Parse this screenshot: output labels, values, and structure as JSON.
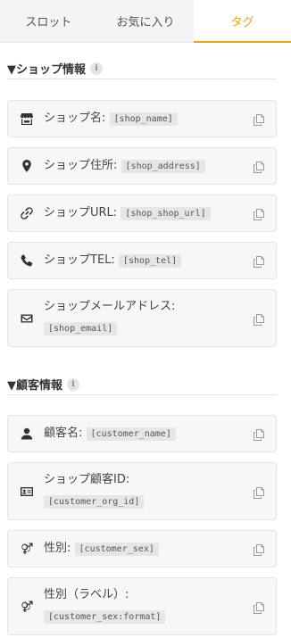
{
  "tabs": [
    {
      "label": "スロット",
      "active": false
    },
    {
      "label": "お気に入り",
      "active": false
    },
    {
      "label": "タグ",
      "active": true
    }
  ],
  "sections": [
    {
      "title": "▼ショップ情報",
      "info": "i",
      "items": [
        {
          "label": "ショップ名:",
          "tag": "[shop_name]",
          "icon": "store-icon"
        },
        {
          "label": "ショップ住所:",
          "tag": "[shop_address]",
          "icon": "location-pin-icon"
        },
        {
          "label": "ショップURL:",
          "tag": "[shop_shop_url]",
          "icon": "link-icon"
        },
        {
          "label": "ショップTEL:",
          "tag": "[shop_tel]",
          "icon": "phone-icon"
        },
        {
          "label": "ショップメールアドレス:",
          "tag": "[shop_email]",
          "icon": "mail-icon"
        }
      ]
    },
    {
      "title": "▼顧客情報",
      "info": "i",
      "items": [
        {
          "label": "顧客名:",
          "tag": "[customer_name]",
          "icon": "person-icon"
        },
        {
          "label": "ショップ顧客ID:",
          "tag": "[customer_org_id]",
          "icon": "id-card-icon"
        },
        {
          "label": "性別:",
          "tag": "[customer_sex]",
          "icon": "gender-icon"
        },
        {
          "label": "性別（ラベル）:",
          "tag": "[customer_sex:format]",
          "icon": "gender-icon"
        }
      ]
    }
  ],
  "colors": {
    "accent": "#e9a40f",
    "card_bg": "#f7f7f7",
    "code_bg": "#e6e6e6"
  }
}
